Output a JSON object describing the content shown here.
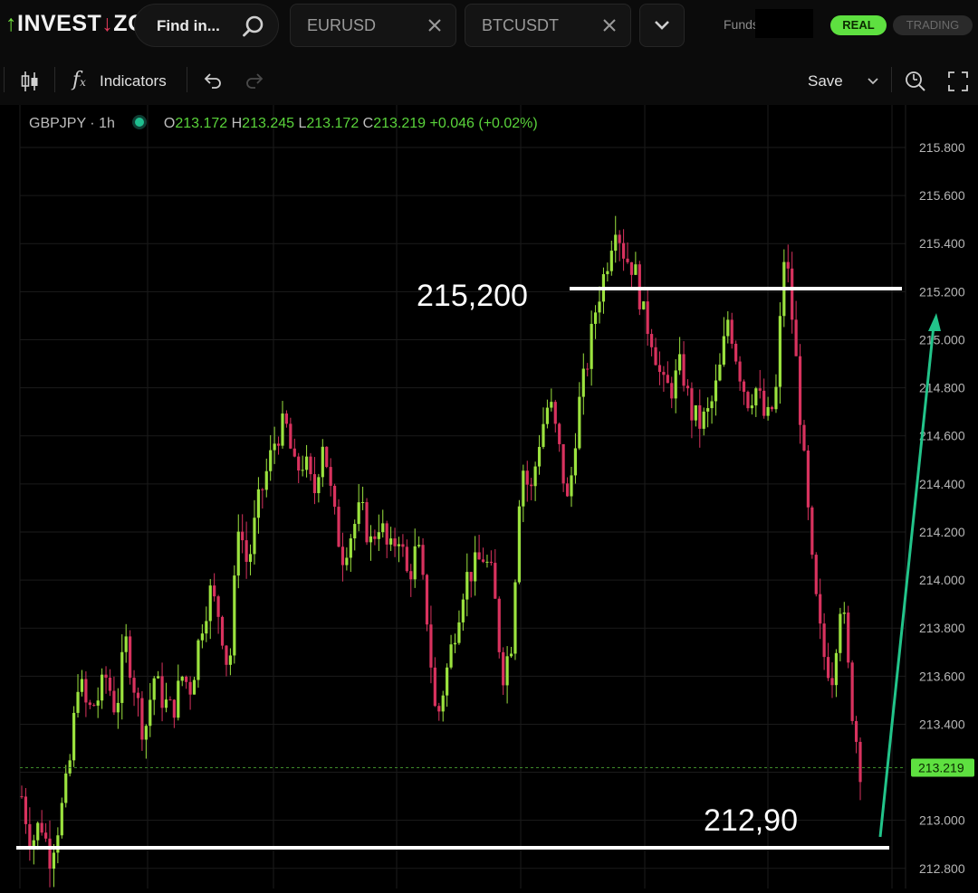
{
  "app": {
    "logo_prefix": "INVEST",
    "logo_accent": "I",
    "logo_suffix": "ZO",
    "brand_color": "#6fdc3c"
  },
  "header": {
    "search_placeholder": "Find in...",
    "tabs": [
      {
        "label": "EURUSD"
      },
      {
        "label": "BTCUSDT"
      }
    ],
    "funds_label": "Funds",
    "mode_real": "REAL",
    "mode_trading": "TRADING"
  },
  "toolbar": {
    "indicators_label": "Indicators",
    "save_label": "Save",
    "icons": [
      "candlestick-icon",
      "function-icon",
      "undo-icon",
      "redo-icon",
      "chevron-down-icon",
      "crosshair-search-icon",
      "fullscreen-icon"
    ]
  },
  "legend": {
    "symbol": "GBPJPY",
    "interval": "1h",
    "open_label": "O",
    "open": "213.172",
    "high_label": "H",
    "high": "213.245",
    "low_label": "L",
    "low": "213.172",
    "close_label": "C",
    "close": "213.219",
    "change": "+0.046 (+0.02%)"
  },
  "annotations": {
    "resistance_label": "215,200",
    "support_label": "212,90"
  },
  "colors": {
    "up": "#9be23e",
    "down": "#d8325e",
    "current_price_bg": "#5ee040",
    "annotation_line": "#ffffff",
    "arrow": "#22c48a"
  },
  "chart_data": {
    "type": "candlestick",
    "symbol": "GBPJPY",
    "interval": "1h",
    "ylim": [
      212.75,
      215.9
    ],
    "y_ticks": [
      "215.800",
      "215.600",
      "215.400",
      "215.200",
      "215.000",
      "214.800",
      "214.600",
      "214.400",
      "214.200",
      "214.000",
      "213.800",
      "213.600",
      "213.400",
      "213.200",
      "213.000",
      "212.800"
    ],
    "current_price": "213.219",
    "close_path": [
      213.1,
      212.9,
      213.0,
      212.85,
      213.0,
      213.2,
      213.6,
      213.45,
      213.5,
      213.6,
      213.45,
      213.75,
      213.55,
      213.35,
      213.6,
      213.5,
      213.45,
      213.6,
      213.55,
      213.8,
      213.95,
      213.85,
      213.6,
      214.25,
      214.05,
      214.3,
      214.45,
      214.6,
      214.65,
      214.45,
      214.5,
      214.35,
      214.6,
      214.3,
      214.1,
      214.2,
      214.3,
      214.15,
      214.25,
      214.1,
      214.2,
      214.0,
      214.15,
      213.85,
      213.4,
      213.6,
      213.8,
      214.0,
      214.05,
      214.1,
      214.0,
      213.6,
      213.75,
      214.5,
      214.35,
      214.6,
      214.75,
      214.55,
      214.3,
      214.7,
      214.9,
      215.15,
      215.3,
      215.5,
      215.35,
      215.3,
      215.1,
      215.0,
      214.8,
      214.8,
      214.9,
      214.7,
      214.65,
      214.7,
      214.85,
      215.1,
      214.9,
      214.75,
      214.8,
      214.65,
      214.75,
      215.4,
      215.0,
      214.5,
      214.0,
      213.7,
      213.6,
      213.95,
      213.5,
      213.219
    ]
  }
}
